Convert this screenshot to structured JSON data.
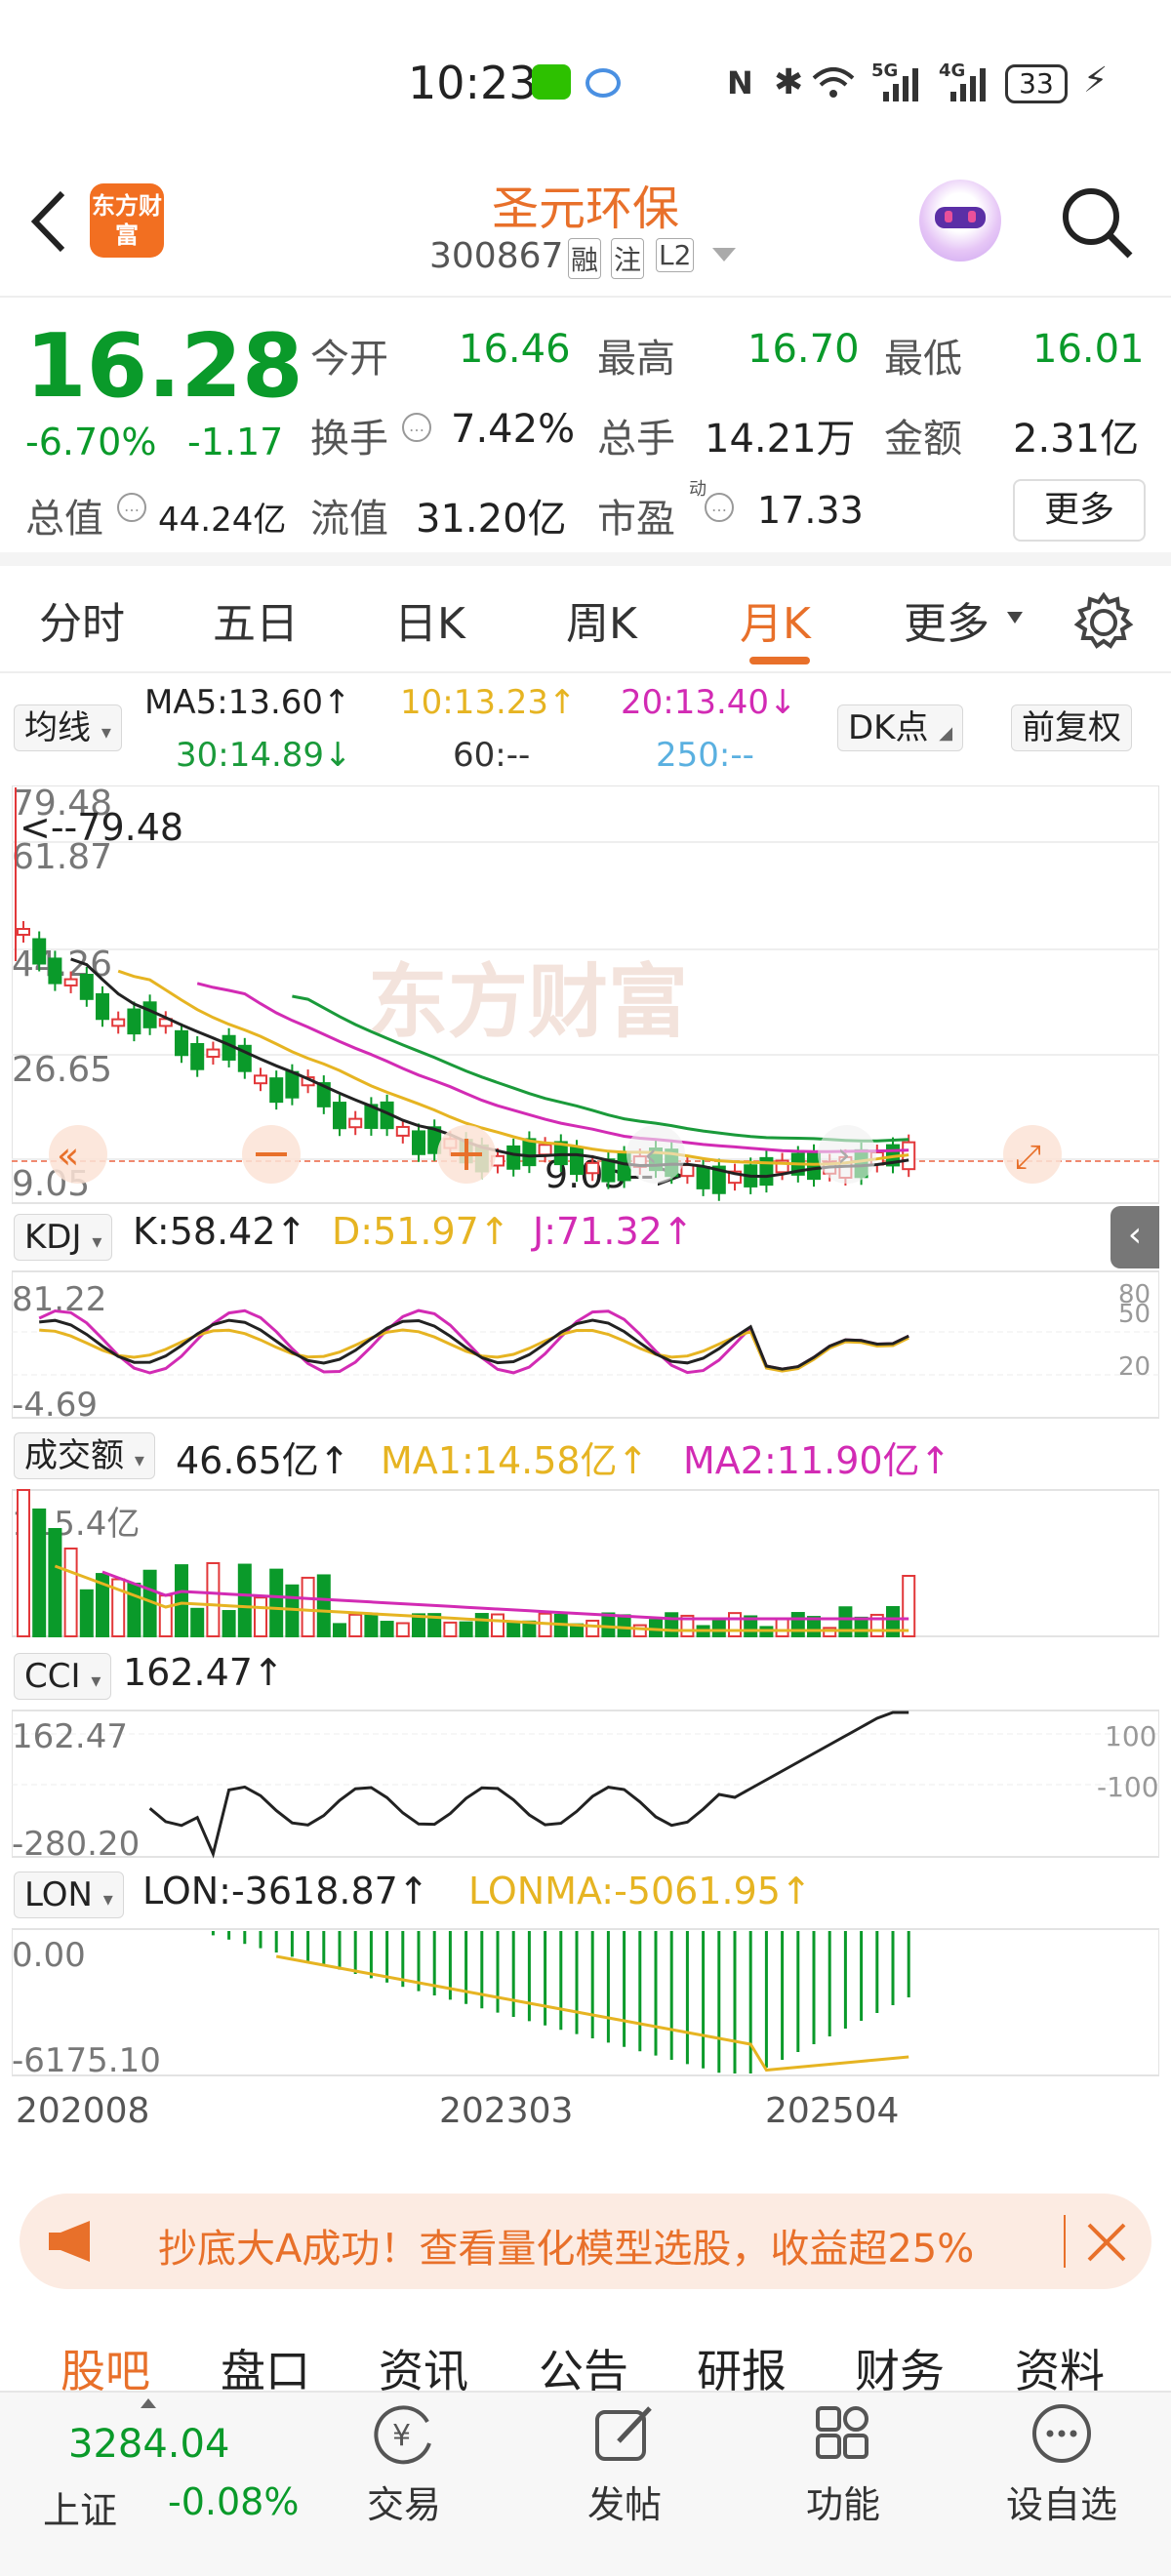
{
  "status_bar": {
    "time": "10:23",
    "network": "5G",
    "network2": "4G",
    "battery": "33"
  },
  "header": {
    "title": "圣元环保",
    "code": "300867",
    "tags": [
      "融",
      "注",
      "L2"
    ],
    "logo_text": "东方财富"
  },
  "quote": {
    "price": "16.28",
    "change_pct": "-6.70%",
    "change": "-1.17",
    "open_label": "今开",
    "open": "16.46",
    "high_label": "最高",
    "high": "16.70",
    "low_label": "最低",
    "low": "16.01",
    "turnover_label": "换手",
    "turnover": "7.42%",
    "volume_label": "总手",
    "volume": "14.21万",
    "amount_label": "金额",
    "amount": "2.31亿",
    "mktcap_label": "总值",
    "mktcap": "44.24亿",
    "float_label": "流值",
    "float": "31.20亿",
    "pe_label": "市盈",
    "pe_sup": "动",
    "pe": "17.33",
    "more_label": "更多"
  },
  "tabs": [
    "分时",
    "五日",
    "日K",
    "周K",
    "月K",
    "更多"
  ],
  "active_tab": "月K",
  "ma_bar": {
    "selector": "均线",
    "ma5": "MA5:13.60↑",
    "ma10": "10:13.23↑",
    "ma20": "20:13.40↓",
    "ma30": "30:14.89↓",
    "ma60": "60:--",
    "ma250": "250:--",
    "dk": "DK点",
    "adjust": "前复权"
  },
  "kline": {
    "watermark": "东方财富",
    "y_labels": [
      "79.48",
      "61.87",
      "44.26",
      "26.65",
      "9.05"
    ],
    "max_marker": "<--79.48",
    "min_marker": "9.05-->"
  },
  "kdj": {
    "selector": "KDJ",
    "k": "K:58.42↑",
    "d": "D:51.97↑",
    "j": "J:71.32↑",
    "y_top": "81.22",
    "y_bottom": "-4.69",
    "ref_labels": [
      "80",
      "50",
      "20"
    ]
  },
  "vol": {
    "selector": "成交额",
    "value": "46.65亿↑",
    "ma1": "MA1:14.58亿↑",
    "ma2": "MA2:11.90亿↑",
    "y_top": "115.4亿"
  },
  "cci": {
    "selector": "CCI",
    "value": "162.47↑",
    "y_top": "162.47",
    "y_bottom": "-280.20",
    "ref_labels": [
      "100",
      "-100"
    ]
  },
  "lon": {
    "selector": "LON",
    "value": "LON:-3618.87↑",
    "lonma": "LONMA:-5061.95↑",
    "y_top": "0.00",
    "y_bottom": "-6175.10"
  },
  "x_labels": [
    "202008",
    "202303",
    "202504"
  ],
  "banner": {
    "text": "抄底大A成功！查看量化模型选股，收益超25%"
  },
  "nav_tabs": [
    "股吧",
    "盘口",
    "资讯",
    "公告",
    "研报",
    "财务",
    "资料"
  ],
  "active_nav_tab": "股吧",
  "bottom": {
    "index_value": "3284.04",
    "index_name": "上证",
    "index_change": "-0.08%",
    "buttons": [
      {
        "label": "交易",
        "icon": "yuan-trade-icon"
      },
      {
        "label": "发帖",
        "icon": "edit-icon"
      },
      {
        "label": "功能",
        "icon": "grid-icon"
      },
      {
        "label": "设自选",
        "icon": "more-dots-icon"
      }
    ]
  },
  "colors": {
    "up": "#e2383a",
    "down": "#0a9a2a",
    "accent": "#e8702a",
    "ma5": "#222222",
    "ma10": "#e6b422",
    "ma20": "#d22bb4",
    "ma30": "#1a9a3a",
    "ma250": "#5ab0e0"
  }
}
